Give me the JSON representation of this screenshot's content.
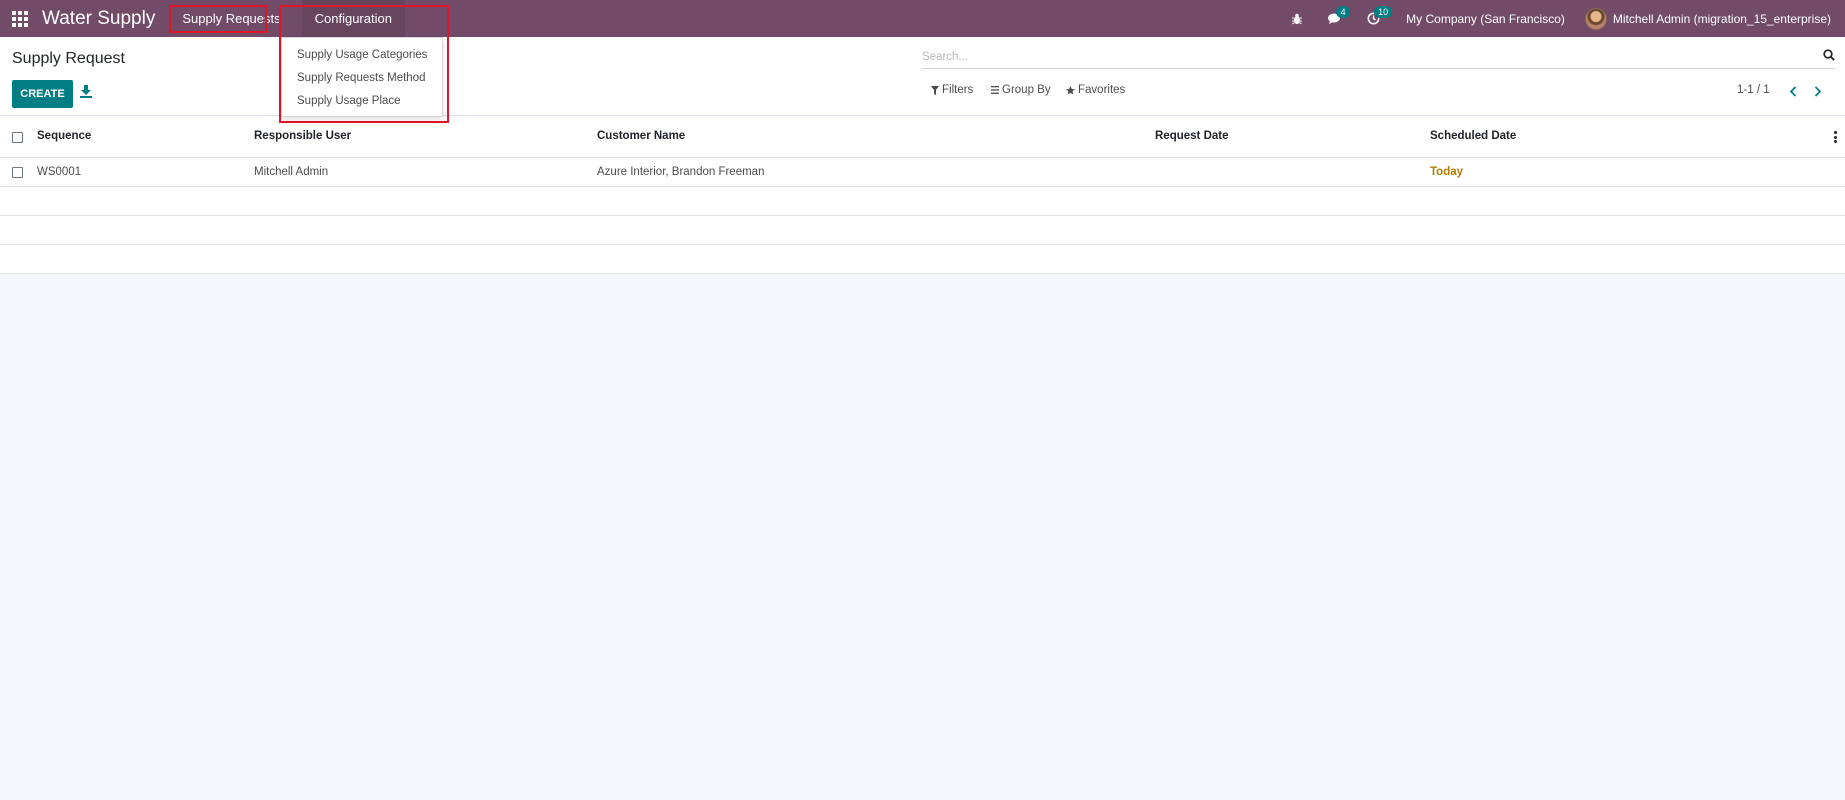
{
  "navbar": {
    "app_name": "Water Supply",
    "menus": [
      "Supply Requests",
      "Configuration"
    ],
    "chat_badge": "4",
    "activity_badge": "10",
    "company": "My Company (San Francisco)",
    "user": "Mitchell Admin (migration_15_enterprise)"
  },
  "dropdown": {
    "items": [
      "Supply Usage Categories",
      "Supply Requests Method",
      "Supply Usage Place"
    ]
  },
  "control_panel": {
    "title": "Supply Request",
    "create_label": "CREATE",
    "search_placeholder": "Search...",
    "filters_label": "Filters",
    "group_by_label": "Group By",
    "favorites_label": "Favorites",
    "pager": "1-1 / 1"
  },
  "table": {
    "columns": [
      "Sequence",
      "Responsible User",
      "Customer Name",
      "Request Date",
      "Scheduled Date"
    ],
    "rows": [
      {
        "sequence": "WS0001",
        "responsible_user": "Mitchell Admin",
        "customer_name": "Azure Interior, Brandon Freeman",
        "request_date": "",
        "scheduled_date": "Today"
      }
    ]
  },
  "colors": {
    "navbar": "#714b67",
    "primary": "#017e84",
    "highlight": "#e0162b",
    "today": "#b37e00"
  }
}
